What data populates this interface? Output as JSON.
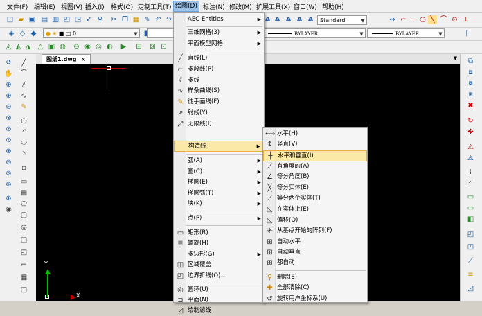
{
  "menubar": {
    "items": [
      {
        "label": "文件(F)"
      },
      {
        "label": "编辑(E)"
      },
      {
        "label": "视图(V)"
      },
      {
        "label": "插入(I)"
      },
      {
        "label": "格式(O)"
      },
      {
        "label": "定制工具(T)"
      },
      {
        "label": "绘图(D)"
      },
      {
        "label": "标注(N)"
      },
      {
        "label": "修改(M)"
      },
      {
        "label": "扩展工具(X)"
      },
      {
        "label": "窗口(W)"
      },
      {
        "label": "帮助(H)"
      }
    ],
    "active_index": 6
  },
  "toolbar": {
    "text_style": "Standard",
    "layer": "0",
    "linetype": "BYLAYER",
    "lineweight": "BYLAYER"
  },
  "document_tab": {
    "label": "图纸1.dwg",
    "close": "×"
  },
  "ucs": {
    "x_label": "X",
    "y_label": "Y"
  },
  "draw_menu": {
    "items": [
      {
        "label": "AEC Entities",
        "submenu": true
      },
      {
        "label": "三维网格(3)",
        "submenu": true
      },
      {
        "label": "平面模型网格",
        "submenu": true
      },
      {
        "label": "直线(L)",
        "icon": "line-icon"
      },
      {
        "label": "多段线(P)",
        "icon": "polyline-icon"
      },
      {
        "label": "多线",
        "icon": "multiline-icon"
      },
      {
        "label": "样条曲线(S)",
        "icon": "spline-icon"
      },
      {
        "label": "徒手画线(F)",
        "icon": "sketch-icon"
      },
      {
        "label": "射线(Y)",
        "icon": "ray-icon"
      },
      {
        "label": "无限线(I)",
        "icon": "xline-icon"
      },
      {
        "label": "构造线",
        "submenu": true,
        "highlighted": true
      },
      {
        "label": "弧(A)",
        "submenu": true
      },
      {
        "label": "圆(C)",
        "submenu": true
      },
      {
        "label": "椭圆(E)",
        "submenu": true
      },
      {
        "label": "椭圆弧(T)",
        "submenu": true
      },
      {
        "label": "块(K)",
        "submenu": true
      },
      {
        "label": "点(P)",
        "submenu": true
      },
      {
        "label": "矩形(R)",
        "icon": "rectangle-icon"
      },
      {
        "label": "螺旋(H)",
        "icon": "helix-icon"
      },
      {
        "label": "多边形(G)",
        "submenu": true
      },
      {
        "label": "区域覆盖",
        "icon": "wipeout-icon"
      },
      {
        "label": "边界折线(O)...",
        "icon": "boundary-icon"
      },
      {
        "label": "圆环(U)",
        "icon": "donut-icon"
      },
      {
        "label": "平面(N)",
        "icon": "plane-icon"
      },
      {
        "label": "绘制滤线",
        "icon": "filter-icon"
      }
    ]
  },
  "construction_submenu": {
    "items": [
      {
        "label": "水平(H)"
      },
      {
        "label": "竖直(V)"
      },
      {
        "label": "水平和垂直(I)",
        "highlighted": true
      },
      {
        "label": "有角度的(A)"
      },
      {
        "label": "等分角度(B)"
      },
      {
        "label": "等分实体(E)"
      },
      {
        "label": "等分两个实体(T)"
      },
      {
        "label": "在实体上(E)"
      },
      {
        "label": "偏移(O)"
      },
      {
        "label": "从基点开始的阵列(F)"
      },
      {
        "label": "自动水平"
      },
      {
        "label": "自动垂直"
      },
      {
        "label": "都自动"
      },
      {
        "label": "删除(E)"
      },
      {
        "label": "全部清除(C)"
      },
      {
        "label": "旋转用户坐标系(U)"
      }
    ]
  }
}
